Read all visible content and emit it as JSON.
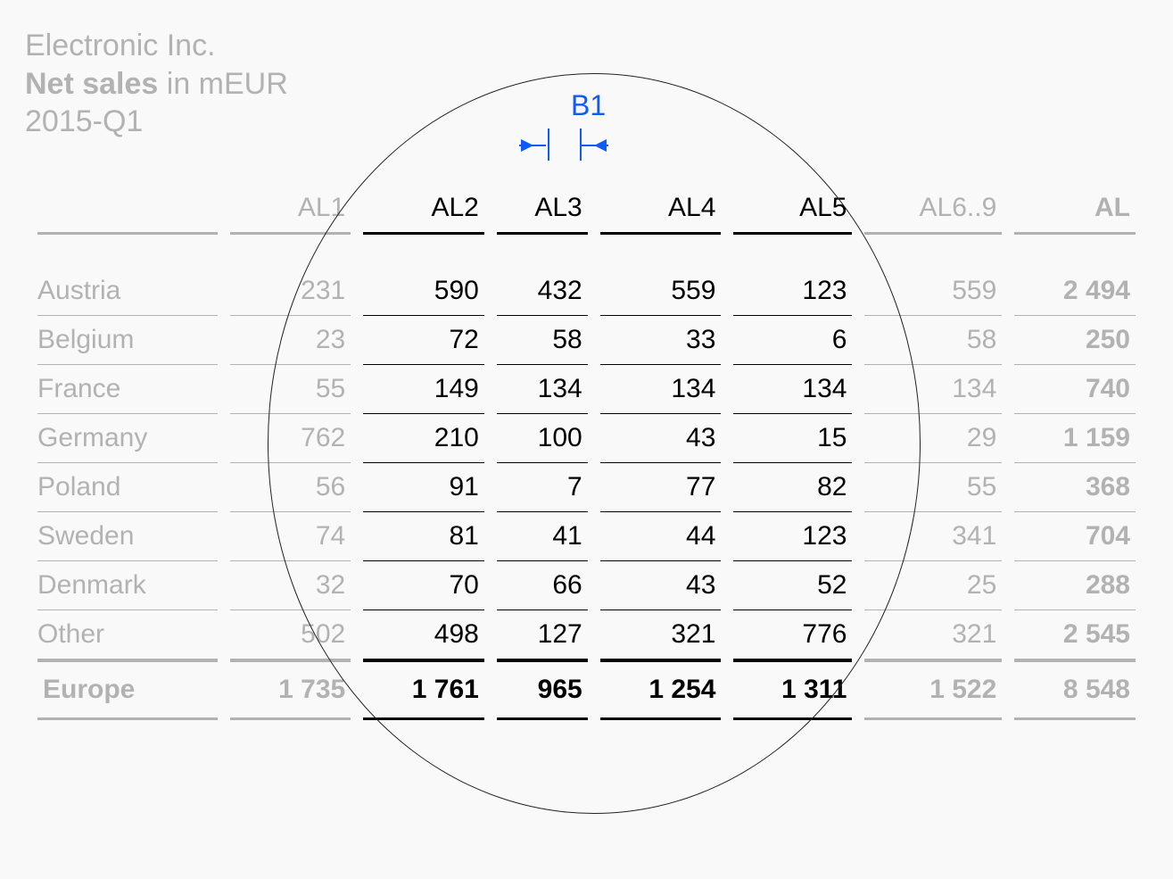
{
  "title": {
    "company": "Electronic Inc.",
    "metric_bold": "Net sales",
    "metric_rest": " in mEUR",
    "period": "2015-Q1"
  },
  "callout": {
    "b1": "B1"
  },
  "chart_data": {
    "type": "table",
    "title": "Electronic Inc. Net sales in mEUR 2015-Q1",
    "columns": [
      "AL1",
      "AL2",
      "AL3",
      "AL4",
      "AL5",
      "AL6..9",
      "AL"
    ],
    "rows": [
      {
        "label": "Austria",
        "values": [
          "231",
          "590",
          "432",
          "559",
          "123",
          "559",
          "2 494"
        ]
      },
      {
        "label": "Belgium",
        "values": [
          "23",
          "72",
          "58",
          "33",
          "6",
          "58",
          "250"
        ]
      },
      {
        "label": "France",
        "values": [
          "55",
          "149",
          "134",
          "134",
          "134",
          "134",
          "740"
        ]
      },
      {
        "label": "Germany",
        "values": [
          "762",
          "210",
          "100",
          "43",
          "15",
          "29",
          "1 159"
        ]
      },
      {
        "label": "Poland",
        "values": [
          "56",
          "91",
          "7",
          "77",
          "82",
          "55",
          "368"
        ]
      },
      {
        "label": "Sweden",
        "values": [
          "74",
          "81",
          "41",
          "44",
          "123",
          "341",
          "704"
        ]
      },
      {
        "label": "Denmark",
        "values": [
          "32",
          "70",
          "66",
          "43",
          "52",
          "25",
          "288"
        ]
      },
      {
        "label": "Other",
        "values": [
          "502",
          "498",
          "127",
          "321",
          "776",
          "321",
          "2 545"
        ]
      }
    ],
    "totals": {
      "label": "Europe",
      "values": [
        "1 735",
        "1 761",
        "965",
        "1 254",
        "1 311",
        "1 522",
        "8 548"
      ]
    },
    "focus_columns": [
      1,
      2,
      3,
      4
    ]
  }
}
